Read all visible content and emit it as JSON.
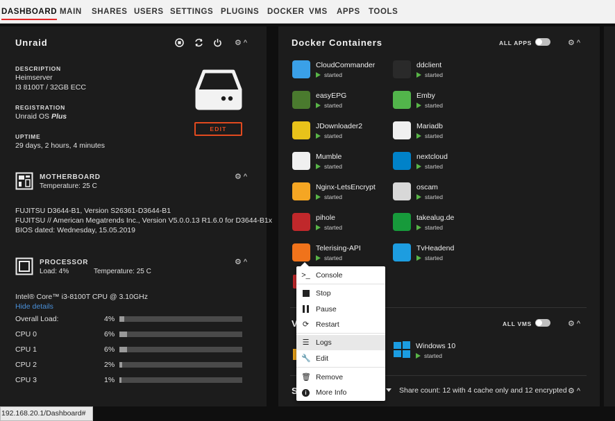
{
  "nav": {
    "items": [
      "DASHBOARD",
      "MAIN",
      "SHARES",
      "USERS",
      "SETTINGS",
      "PLUGINS",
      "DOCKER",
      "VMS",
      "APPS",
      "TOOLS"
    ]
  },
  "server": {
    "title": "Unraid",
    "description_label": "DESCRIPTION",
    "description_name": "Heimserver",
    "description_hw": "I3 8100T / 32GB ECC",
    "registration_label": "REGISTRATION",
    "registration_prefix": "Unraid OS",
    "registration_plan": "Plus",
    "uptime_label": "UPTIME",
    "uptime_value": "29 days, 2 hours, 4 minutes",
    "edit_label": "EDIT"
  },
  "motherboard": {
    "title": "MOTHERBOARD",
    "temperature": "Temperature: 25 C",
    "line1": "FUJITSU D3644-B1, Version S26361-D3644-B1",
    "line2": "FUJITSU // American Megatrends Inc., Version V5.0.0.13 R1.6.0 for D3644-B1x",
    "line3": "BIOS dated: Wednesday, 15.05.2019"
  },
  "processor": {
    "title": "PROCESSOR",
    "load": "Load: 4%",
    "temperature": "Temperature: 25 C",
    "model": "Intel® Core™ i3-8100T CPU @ 3.10GHz",
    "hide_details": "Hide details",
    "rows": [
      {
        "label": "Overall Load:",
        "value": "4%",
        "pct": 4
      },
      {
        "label": "CPU 0",
        "value": "6%",
        "pct": 6
      },
      {
        "label": "CPU 1",
        "value": "6%",
        "pct": 6
      },
      {
        "label": "CPU 2",
        "value": "2%",
        "pct": 2
      },
      {
        "label": "CPU 3",
        "value": "1%",
        "pct": 1
      }
    ]
  },
  "docker": {
    "title": "Docker Containers",
    "all_apps_label": "ALL APPS",
    "containers": [
      {
        "name": "CloudCommander",
        "status": "started",
        "color": "#3aa0e8"
      },
      {
        "name": "ddclient",
        "status": "started",
        "color": "#2a2a2a"
      },
      {
        "name": "easyEPG",
        "status": "started",
        "color": "#4a7a2e"
      },
      {
        "name": "Emby",
        "status": "started",
        "color": "#52b54b"
      },
      {
        "name": "JDownloader2",
        "status": "started",
        "color": "#e8c21a"
      },
      {
        "name": "Mariadb",
        "status": "started",
        "color": "#f0f0f0"
      },
      {
        "name": "Mumble",
        "status": "started",
        "color": "#f0f0f0"
      },
      {
        "name": "nextcloud",
        "status": "started",
        "color": "#0082c9"
      },
      {
        "name": "Nginx-LetsEncrypt",
        "status": "started",
        "color": "#f5a623"
      },
      {
        "name": "oscam",
        "status": "started",
        "color": "#d8d8d8"
      },
      {
        "name": "pihole",
        "status": "started",
        "color": "#c0282b"
      },
      {
        "name": "takealug.de",
        "status": "started",
        "color": "#179a3b"
      },
      {
        "name": "Telerising-API",
        "status": "started",
        "color": "#f0731b"
      },
      {
        "name": "TvHeadend",
        "status": "started",
        "color": "#1d9de0"
      }
    ]
  },
  "vms": {
    "all_vms_label": "ALL VMS",
    "vm_name": "Windows 10",
    "vm_status": "started",
    "partial_letter": "V"
  },
  "shares": {
    "partial_letter": "S",
    "share_count": "Share count: 12 with 4 cache only and 12 encrypted"
  },
  "context_menu": {
    "items": [
      {
        "label": "Console",
        "icon": "console-icon"
      },
      {
        "label": "Stop",
        "icon": "stop-icon"
      },
      {
        "label": "Pause",
        "icon": "pause-icon"
      },
      {
        "label": "Restart",
        "icon": "restart-icon"
      },
      {
        "label": "Logs",
        "icon": "logs-icon"
      },
      {
        "label": "Edit",
        "icon": "wrench-icon"
      },
      {
        "label": "Remove",
        "icon": "trash-icon"
      },
      {
        "label": "More Info",
        "icon": "info-icon"
      }
    ]
  },
  "statusbar": {
    "url": "192.168.20.1/Dashboard#"
  },
  "colors": {
    "accent": "#e22828",
    "edit": "#e24a1f",
    "started": "#59b548",
    "link": "#4a90d9"
  }
}
